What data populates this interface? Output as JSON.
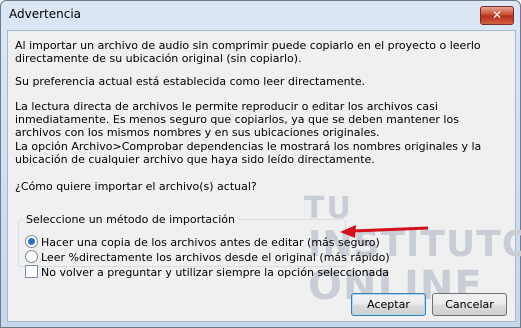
{
  "window": {
    "title": "Advertencia",
    "close_symbol": "✕"
  },
  "message": {
    "p1": "Al importar un archivo de audio sin comprimir puede copiarlo en el proyecto o leerlo directamente de su ubicación original (sin copiarlo).",
    "p2": "Su preferencia actual está establecida como leer directamente.",
    "p3": "La lectura directa de archivos le permite reproducir o editar los archivos casi inmediatamente. Es menos seguro que copiarlos, ya que se deben mantener los archivos con los mismos nombres y en sus ubicaciones originales.",
    "p4": "La opción Archivo>Comprobar dependencias le mostrará los nombres originales y la ubicación de cualquier archivo que haya sido leído directamente.",
    "p5": "¿Cómo quiere importar el archivo(s) actual?"
  },
  "import_group": {
    "legend": "Seleccione un método de importación",
    "options": [
      {
        "label": "Hacer una copia de los archivos antes de editar (más seguro)",
        "selected": true
      },
      {
        "label": "Leer %directamente los archivos desde el original (más rápido)",
        "selected": false
      }
    ],
    "dont_ask_label": "No volver a preguntar y utilizar siempre la opción seleccionada",
    "dont_ask_checked": false
  },
  "watermark": {
    "line1": "TU",
    "line2": "INSTITUTO",
    "line3": "ONLINE"
  },
  "buttons": {
    "accept": "Aceptar",
    "cancel": "Cancelar"
  },
  "colors": {
    "arrow": "#d4101a",
    "radio_selected": "#2a72c6"
  },
  "icons": {
    "close": "close-icon",
    "arrow": "arrow-left-icon"
  }
}
